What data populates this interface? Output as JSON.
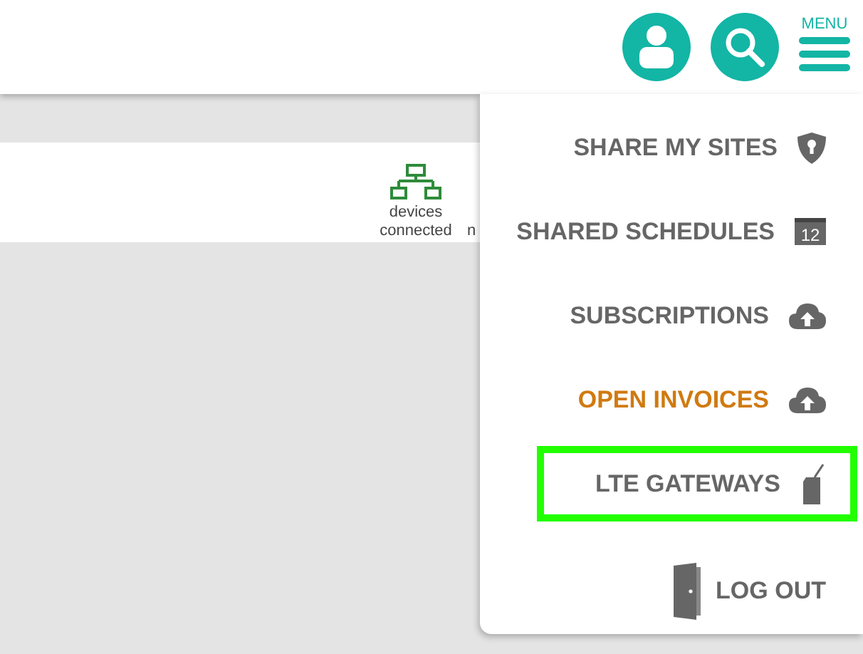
{
  "header": {
    "menu_label": "MENU"
  },
  "device_stat": {
    "label": "devices connected",
    "cut_label": "n"
  },
  "menu": {
    "items": [
      {
        "label": "SHARE MY SITES",
        "kind": "shield",
        "attention": false,
        "selected": false
      },
      {
        "label": "SHARED SCHEDULES",
        "kind": "calendar",
        "icon_text": "12",
        "attention": false,
        "selected": false
      },
      {
        "label": "SUBSCRIPTIONS",
        "kind": "cloud",
        "attention": false,
        "selected": false
      },
      {
        "label": "OPEN INVOICES",
        "kind": "cloud",
        "attention": true,
        "selected": false
      },
      {
        "label": "LTE GATEWAYS",
        "kind": "sim",
        "attention": false,
        "selected": true
      },
      {
        "label": "LOG OUT",
        "kind": "door",
        "attention": false,
        "selected": false
      }
    ]
  }
}
